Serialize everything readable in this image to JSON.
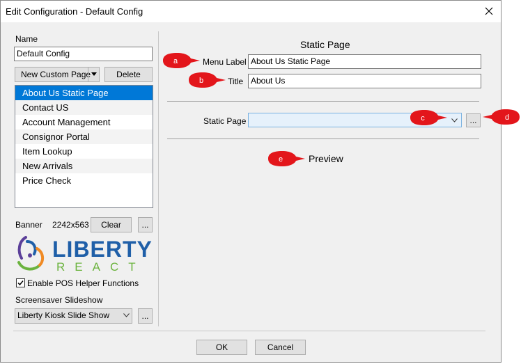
{
  "window": {
    "title": "Edit Configuration - Default Config"
  },
  "left": {
    "name_label": "Name",
    "name_value": "Default Config",
    "new_custom_page_label": "New Custom Page",
    "delete_label": "Delete",
    "pages": [
      "About Us Static Page",
      "Contact US",
      "Account Management",
      "Consignor Portal",
      "Item Lookup",
      "New Arrivals",
      "Price Check"
    ],
    "banner_label": "Banner",
    "banner_size": "2242x563",
    "clear_label": "Clear",
    "ellipsis": "...",
    "logo": {
      "line1": "LIBERTY",
      "line2": "REACT"
    },
    "pos_helper_label": "Enable POS Helper Functions",
    "screensaver_label": "Screensaver Slideshow",
    "screensaver_value": "Liberty Kiosk Slide Show"
  },
  "right": {
    "section_title": "Static Page",
    "menu_label_label": "Menu Label",
    "menu_label_value": "About Us Static Page",
    "title_label": "Title",
    "title_value": "About Us",
    "static_page_label": "Static Page",
    "static_page_value": "",
    "browse_label": "...",
    "preview_label": "Preview"
  },
  "footer": {
    "ok_label": "OK",
    "cancel_label": "Cancel"
  },
  "callouts": {
    "a": "a",
    "b": "b",
    "c": "c",
    "d": "d",
    "e": "e"
  },
  "colors": {
    "selection": "#0078d7",
    "callout": "#e3161b",
    "logo_blue": "#1f5fa8",
    "logo_green": "#6bb33e"
  }
}
